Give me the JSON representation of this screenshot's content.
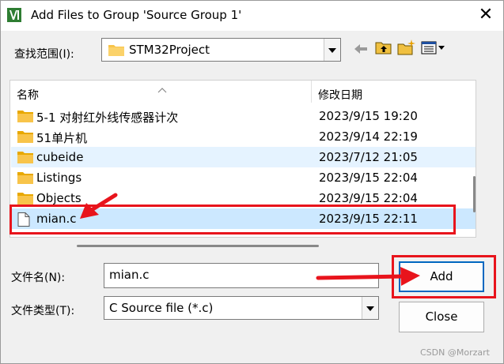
{
  "dialog": {
    "title": "Add Files to Group 'Source Group 1'",
    "close_glyph": "✕"
  },
  "look_in": {
    "label": "查找范围(I):",
    "value": "STM32Project"
  },
  "toolbar": {
    "icons": [
      "back-arrow-icon",
      "up-folder-icon",
      "new-folder-icon",
      "view-menu-icon"
    ]
  },
  "list": {
    "columns": {
      "name": "名称",
      "date": "修改日期"
    },
    "rows": [
      {
        "name": "5-1 对射红外线传感器计次",
        "date": "2023/9/15 19:20",
        "type": "folder"
      },
      {
        "name": "51单片机",
        "date": "2023/9/14 22:19",
        "type": "folder"
      },
      {
        "name": "cubeide",
        "date": "2023/7/12 21:05",
        "type": "folder"
      },
      {
        "name": "Listings",
        "date": "2023/9/15 22:04",
        "type": "folder"
      },
      {
        "name": "Objects",
        "date": "2023/9/15 22:04",
        "type": "folder"
      },
      {
        "name": "mian.c",
        "date": "2023/9/15 22:11",
        "type": "file"
      }
    ]
  },
  "filename": {
    "label": "文件名(N):",
    "value": "mian.c"
  },
  "filetype": {
    "label": "文件类型(T):",
    "value": "C Source file (*.c)"
  },
  "buttons": {
    "add": "Add",
    "close": "Close"
  },
  "watermark": "CSDN @Morzart",
  "colors": {
    "annotation_red": "#e8141c",
    "folder_yellow": "#f8c44a",
    "selection": "#cce8ff",
    "hover": "#e5f3ff"
  }
}
